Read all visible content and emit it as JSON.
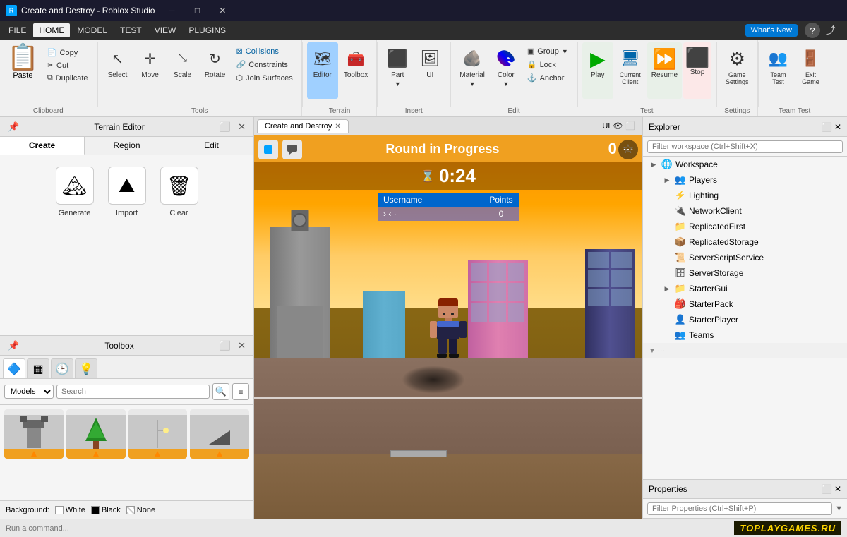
{
  "app": {
    "title": "Create and Destroy - Roblox Studio",
    "icon": "R"
  },
  "titlebar": {
    "minimize": "─",
    "maximize": "□",
    "close": "✕"
  },
  "menubar": {
    "items": [
      {
        "id": "file",
        "label": "FILE"
      },
      {
        "id": "home",
        "label": "HOME",
        "active": true
      },
      {
        "id": "model",
        "label": "MODEL"
      },
      {
        "id": "test",
        "label": "TEST"
      },
      {
        "id": "view",
        "label": "VIEW"
      },
      {
        "id": "plugins",
        "label": "PLUGINS"
      }
    ],
    "whats_new": "What's New"
  },
  "ribbon": {
    "sections": {
      "clipboard": {
        "label": "Clipboard",
        "paste": "Paste",
        "copy": "Copy",
        "cut": "Cut",
        "duplicate": "Duplicate"
      },
      "tools": {
        "label": "Tools",
        "select": "Select",
        "move": "Move",
        "scale": "Scale",
        "rotate": "Rotate",
        "collisions": "Collisions",
        "constraints": "Constraints",
        "join_surfaces": "Join Surfaces"
      },
      "terrain": {
        "label": "Terrain",
        "editor": "Editor",
        "toolbox": "Toolbox"
      },
      "insert": {
        "label": "Insert",
        "part": "Part",
        "ui": "UI"
      },
      "edit": {
        "label": "Edit",
        "material": "Material",
        "color": "Color",
        "group": "Group",
        "lock": "Lock",
        "anchor": "Anchor"
      },
      "test": {
        "label": "Test",
        "play": "Play",
        "current_client": "Current\nClient",
        "resume": "Resume",
        "stop": "Stop"
      },
      "settings": {
        "label": "Settings",
        "game_settings": "Game\nSettings"
      },
      "team_test": {
        "label": "Team Test",
        "team": "Team\nTest",
        "exit_game": "Exit\nGame"
      }
    }
  },
  "terrain_editor": {
    "title": "Terrain Editor",
    "tabs": [
      "Create",
      "Region",
      "Edit"
    ],
    "active_tab": "Create",
    "items": [
      {
        "id": "generate",
        "label": "Generate",
        "icon": "🏔"
      },
      {
        "id": "import",
        "label": "Import",
        "icon": "⛰"
      },
      {
        "id": "clear",
        "label": "Clear",
        "icon": "🗑"
      }
    ]
  },
  "toolbox": {
    "title": "Toolbox",
    "tabs": [
      {
        "id": "models",
        "icon": "🔷",
        "active": true
      },
      {
        "id": "grid",
        "icon": "▦"
      },
      {
        "id": "recent",
        "icon": "🕒"
      },
      {
        "id": "bulb",
        "icon": "💡"
      }
    ],
    "filter": {
      "category": "Models",
      "placeholder": "Search",
      "search_icon": "🔍",
      "filter_icon": "≡"
    },
    "items": [
      {
        "id": "item-1",
        "icon": "🏗"
      },
      {
        "id": "item-2",
        "icon": "🌲"
      },
      {
        "id": "item-3",
        "icon": "💡"
      },
      {
        "id": "item-4",
        "icon": "🔲"
      }
    ]
  },
  "background_selector": {
    "label": "Background:",
    "options": [
      {
        "id": "white",
        "label": "White",
        "color": "#ffffff",
        "selected": true
      },
      {
        "id": "black",
        "label": "Black",
        "color": "#000000"
      },
      {
        "id": "none",
        "label": "None",
        "color": "transparent"
      }
    ]
  },
  "viewport": {
    "tabs": [
      {
        "id": "create-destroy",
        "label": "Create and Destroy",
        "active": true,
        "closeable": true
      }
    ],
    "ui_toggle": "UI",
    "eye_icon": "👁",
    "game": {
      "round_status": "Round in Progress",
      "timer": "0:24",
      "score_label": "0",
      "username_header": "Username",
      "points_header": "Points",
      "score_value": "0",
      "more_options": "⋯"
    }
  },
  "explorer": {
    "title": "Explorer",
    "filter_placeholder": "Filter workspace (Ctrl+Shift+X)",
    "items": [
      {
        "id": "workspace",
        "label": "Workspace",
        "icon": "🌐",
        "expanded": true,
        "indent": 0
      },
      {
        "id": "players",
        "label": "Players",
        "icon": "👥",
        "indent": 1
      },
      {
        "id": "lighting",
        "label": "Lighting",
        "icon": "⚡",
        "indent": 1
      },
      {
        "id": "networkclient",
        "label": "NetworkClient",
        "icon": "🔌",
        "indent": 1
      },
      {
        "id": "replicatedfirst",
        "label": "ReplicatedFirst",
        "icon": "📁",
        "indent": 1
      },
      {
        "id": "replicatedstorage",
        "label": "ReplicatedStorage",
        "icon": "📦",
        "indent": 1
      },
      {
        "id": "serverscriptservice",
        "label": "ServerScriptService",
        "icon": "📜",
        "indent": 1
      },
      {
        "id": "serverstorage",
        "label": "ServerStorage",
        "icon": "🗄",
        "indent": 1
      },
      {
        "id": "startergui",
        "label": "StarterGui",
        "icon": "📁",
        "expanded": true,
        "indent": 1
      },
      {
        "id": "starterpack",
        "label": "StarterPack",
        "icon": "🎒",
        "indent": 1
      },
      {
        "id": "starterplayer",
        "label": "StarterPlayer",
        "icon": "👤",
        "indent": 1
      },
      {
        "id": "teams",
        "label": "Teams",
        "icon": "👥",
        "indent": 1
      }
    ]
  },
  "properties": {
    "title": "Properties",
    "filter_placeholder": "Filter Properties (Ctrl+Shift+P)"
  },
  "statusbar": {
    "run_placeholder": "Run a command...",
    "toplay": "TOPLAYGAMES.RU"
  }
}
